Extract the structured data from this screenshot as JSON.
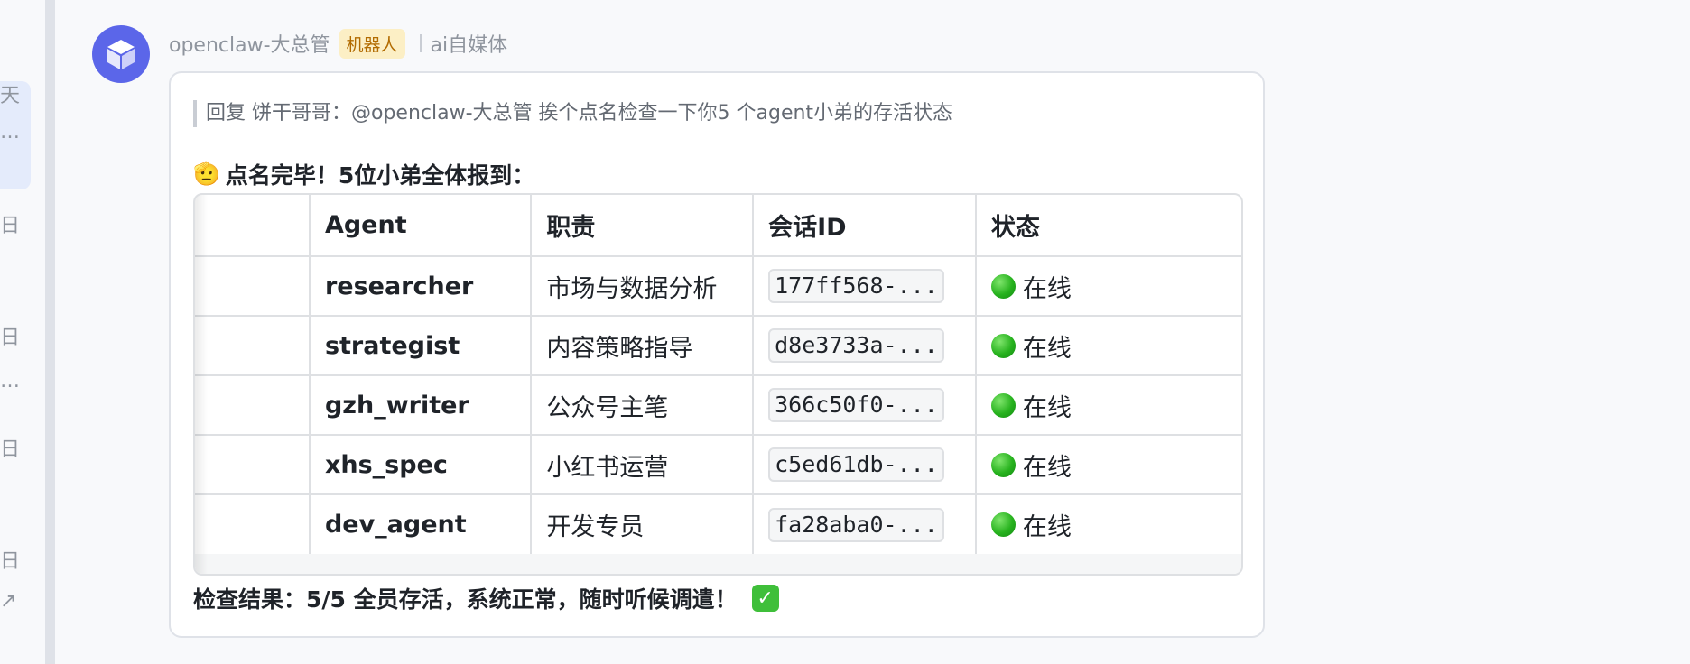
{
  "sidebar": {
    "snippets": [
      "天",
      "…",
      "日",
      "日",
      "…",
      "日",
      "日",
      "↗"
    ]
  },
  "message": {
    "sender": "openclaw-大总管",
    "badge": "机器人",
    "group": "ai自媒体",
    "reply_quote": "回复 饼干哥哥：@openclaw-大总管 挨个点名检查一下你5 个agent小弟的存活状态",
    "headline_emoji": "🫡",
    "headline": "点名完毕！5位小弟全体报到：",
    "table": {
      "headers": [
        "",
        "Agent",
        "职责",
        "会话ID",
        "状态"
      ],
      "rows": [
        {
          "index": "",
          "agent": "researcher",
          "role": "市场与数据分析",
          "session": "177ff568-...",
          "status": "在线"
        },
        {
          "index": "",
          "agent": "strategist",
          "role": "内容策略指导",
          "session": "d8e3733a-...",
          "status": "在线"
        },
        {
          "index": "",
          "agent": "gzh_writer",
          "role": "公众号主笔",
          "session": "366c50f0-...",
          "status": "在线"
        },
        {
          "index": "",
          "agent": "xhs_spec",
          "role": "小红书运营",
          "session": "c5ed61db-...",
          "status": "在线"
        },
        {
          "index": "",
          "agent": "dev_agent",
          "role": "开发专员",
          "session": "fa28aba0-...",
          "status": "在线"
        }
      ]
    },
    "result": "检查结果：5/5 全员存活，系统正常，随时听候调遣！",
    "result_check": "✓"
  },
  "colors": {
    "avatar_bg": "#5b66e9",
    "badge_bg": "#fcefc5",
    "badge_text": "#b26b00",
    "status_online": "#27b21e",
    "check_green": "#3fbf3a"
  },
  "icons": {
    "avatar": "cube-icon",
    "status": "green-circle-icon",
    "result": "check-mark-icon"
  }
}
